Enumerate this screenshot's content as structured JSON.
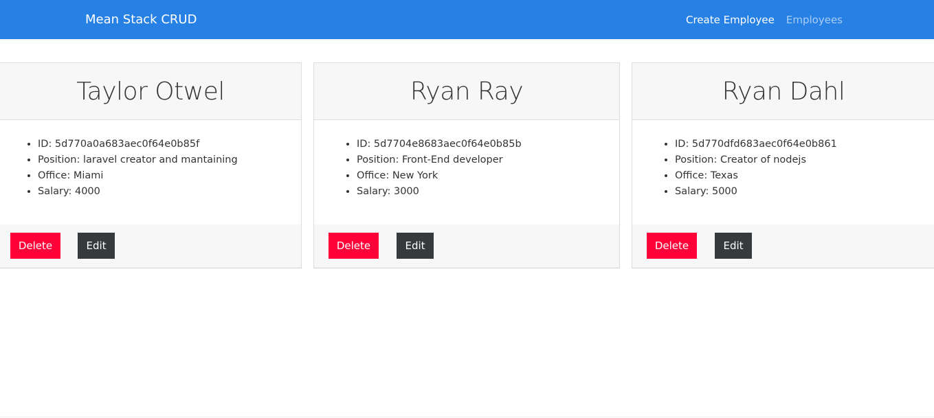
{
  "navbar": {
    "brand": "Mean Stack CRUD",
    "links": [
      {
        "label": "Create Employee"
      },
      {
        "label": "Employees"
      }
    ]
  },
  "employees": [
    {
      "name": "Taylor Otwel",
      "id_text": "ID: 5d770a0a683aec0f64e0b85f",
      "position_text": "Position: laravel creator and mantaining",
      "office_text": "Office: Miami",
      "salary_text": "Salary: 4000"
    },
    {
      "name": "Ryan Ray",
      "id_text": "ID: 5d7704e8683aec0f64e0b85b",
      "position_text": "Position: Front-End developer",
      "office_text": "Office: New York",
      "salary_text": "Salary: 3000"
    },
    {
      "name": "Ryan Dahl",
      "id_text": "ID: 5d770dfd683aec0f64e0b861",
      "position_text": "Position: Creator of nodejs",
      "office_text": "Office: Texas",
      "salary_text": "Salary: 5000"
    }
  ],
  "actions": {
    "delete_label": "Delete",
    "edit_label": "Edit"
  },
  "colors": {
    "navbar": "#2780e3",
    "delete": "#ff0039",
    "edit": "#373a3c"
  }
}
